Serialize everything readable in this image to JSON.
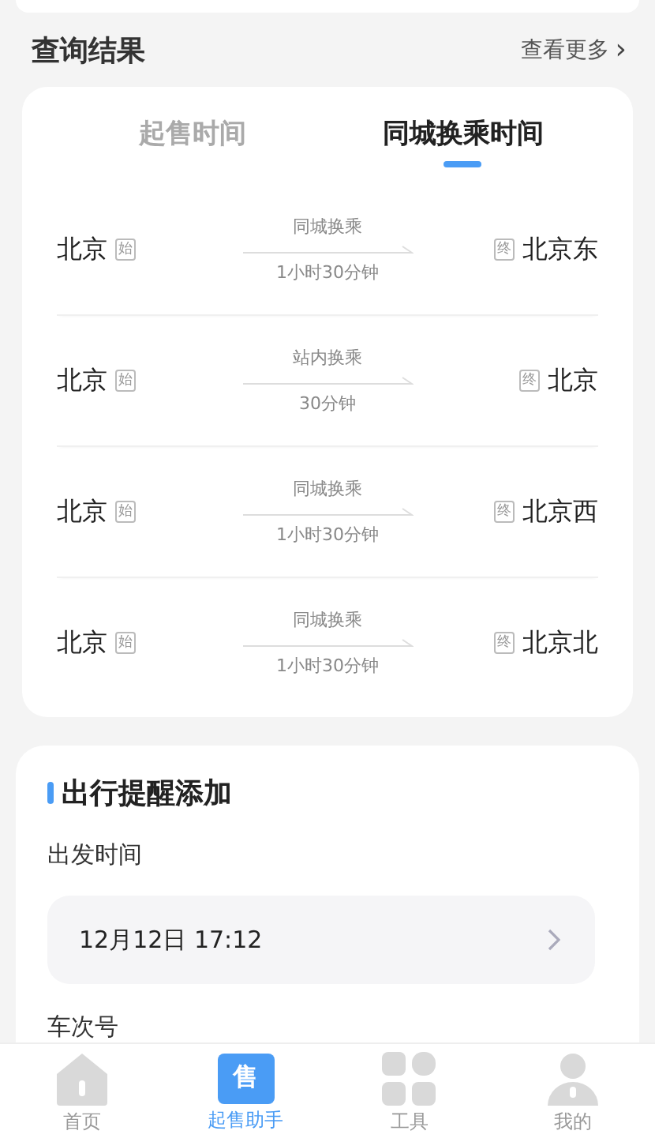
{
  "results": {
    "title": "查询结果",
    "more": "查看更多",
    "more_icon": "›",
    "tabs": [
      {
        "label": "起售时间",
        "selected": false
      },
      {
        "label": "同城换乘时间",
        "selected": true
      }
    ],
    "rows": [
      {
        "from": "北京",
        "from_tag": "始",
        "transfer": "同城换乘",
        "duration": "1小时30分钟",
        "to_tag": "终",
        "to": "北京东"
      },
      {
        "from": "北京",
        "from_tag": "始",
        "transfer": "站内换乘",
        "duration": "30分钟",
        "to_tag": "终",
        "to": "北京"
      },
      {
        "from": "北京",
        "from_tag": "始",
        "transfer": "同城换乘",
        "duration": "1小时30分钟",
        "to_tag": "终",
        "to": "北京西"
      },
      {
        "from": "北京",
        "from_tag": "始",
        "transfer": "同城换乘",
        "duration": "1小时30分钟",
        "to_tag": "终",
        "to": "北京北"
      }
    ]
  },
  "reminder": {
    "title": "出行提醒添加",
    "departure_label": "出发时间",
    "departure_value": "12月12日 17:12",
    "train_label": "车次号"
  },
  "nav": [
    {
      "kind": "home",
      "label": "首页",
      "selected": false
    },
    {
      "kind": "ticket",
      "label": "起售助手",
      "icon_text": "售",
      "selected": true
    },
    {
      "kind": "tools",
      "label": "工具",
      "selected": false
    },
    {
      "kind": "user",
      "label": "我的",
      "selected": false
    }
  ]
}
